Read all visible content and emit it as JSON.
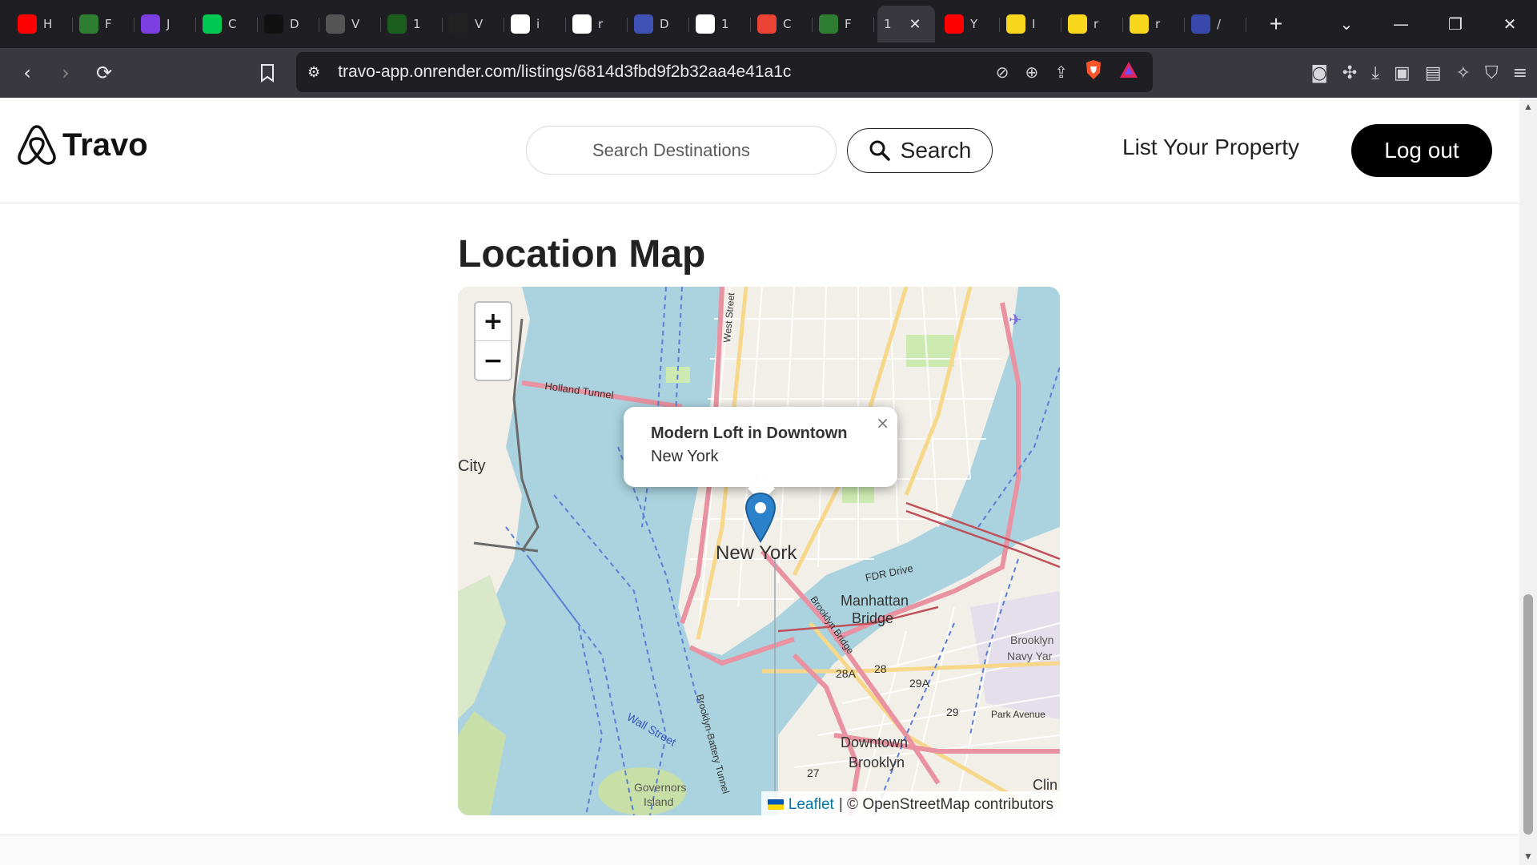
{
  "browser": {
    "tabs": [
      {
        "icon": "youtube-icon",
        "letter": "H",
        "color": "#ff0000"
      },
      {
        "icon": "spark-icon",
        "letter": "F",
        "color": "#2e7d32"
      },
      {
        "icon": "star-app-icon",
        "letter": "J",
        "color": "#7b3fe4"
      },
      {
        "icon": "leaf-icon",
        "letter": "C",
        "color": "#00c853"
      },
      {
        "icon": "openai-icon",
        "letter": "D",
        "color": "#111111"
      },
      {
        "icon": "globe-icon",
        "letter": "V",
        "color": "#555555"
      },
      {
        "icon": "dx-icon",
        "letter": "1",
        "color": "#1b5e20"
      },
      {
        "icon": "is-icon",
        "letter": "V",
        "color": "#222222"
      },
      {
        "icon": "google-icon",
        "letter": "i",
        "color": "#ffffff"
      },
      {
        "icon": "github-icon",
        "letter": "r",
        "color": "#ffffff"
      },
      {
        "icon": "vscode-icon",
        "letter": "D",
        "color": "#3f51b5"
      },
      {
        "icon": "chatgpt-icon",
        "letter": "1",
        "color": "#ffffff"
      },
      {
        "icon": "gmail-icon",
        "letter": "C",
        "color": "#ea4335"
      },
      {
        "icon": "app-check-icon",
        "letter": "F",
        "color": "#2e7d32"
      }
    ],
    "active_tab": {
      "letter": "1",
      "close": "✕"
    },
    "tabs_after": [
      {
        "icon": "youtube-icon",
        "letter": "Y",
        "color": "#ff0000"
      },
      {
        "icon": "flipkart-icon",
        "letter": "I",
        "color": "#f9d71c"
      },
      {
        "icon": "flipkart-icon",
        "letter": "r",
        "color": "#f9d71c"
      },
      {
        "icon": "flipkart-icon",
        "letter": "r",
        "color": "#f9d71c"
      },
      {
        "icon": "cloud-app-icon",
        "letter": "/",
        "color": "#3949ab"
      }
    ],
    "new_tab": "+",
    "url": "travo-app.onrender.com/listings/6814d3fbd9f2b32aa4e41a1c"
  },
  "header": {
    "logo_text": "Travo",
    "search_placeholder": "Search Destinations",
    "search_button": "Search",
    "list_property": "List Your Property",
    "logout": "Log out"
  },
  "map_section": {
    "title": "Location Map",
    "zoom_in": "+",
    "zoom_out": "−",
    "popup_title": "Modern Loft in Downtown",
    "popup_subtitle": "New York",
    "popup_close": "×",
    "attribution_link": "Leaflet",
    "attribution_text": "| © OpenStreetMap contributors",
    "labels": {
      "new_york": "New York",
      "manhattan_bridge_1": "Manhattan",
      "manhattan_bridge_2": "Bridge",
      "downtown_brooklyn_1": "Downtown",
      "downtown_brooklyn_2": "Brooklyn",
      "holland_tunnel": "Holland Tunnel",
      "city": "City",
      "fdr_drive": "FDR Drive",
      "wall_street": "Wall Street",
      "governors_island_1": "Governors",
      "governors_island_2": "Island",
      "brooklyn_navy_1": "Brooklyn",
      "brooklyn_navy_2": "Navy Yar",
      "park_avenue": "Park Avenue",
      "clin": "Clin",
      "west_street": "West Street",
      "brooklyn_bridge": "Brooklyn Bridge",
      "brooklyn_battery_tunnel": "Brooklyn-Battery Tunnel",
      "num_28a": "28A",
      "num_28": "28",
      "num_29a": "29A",
      "num_29": "29",
      "num_27": "27"
    }
  }
}
